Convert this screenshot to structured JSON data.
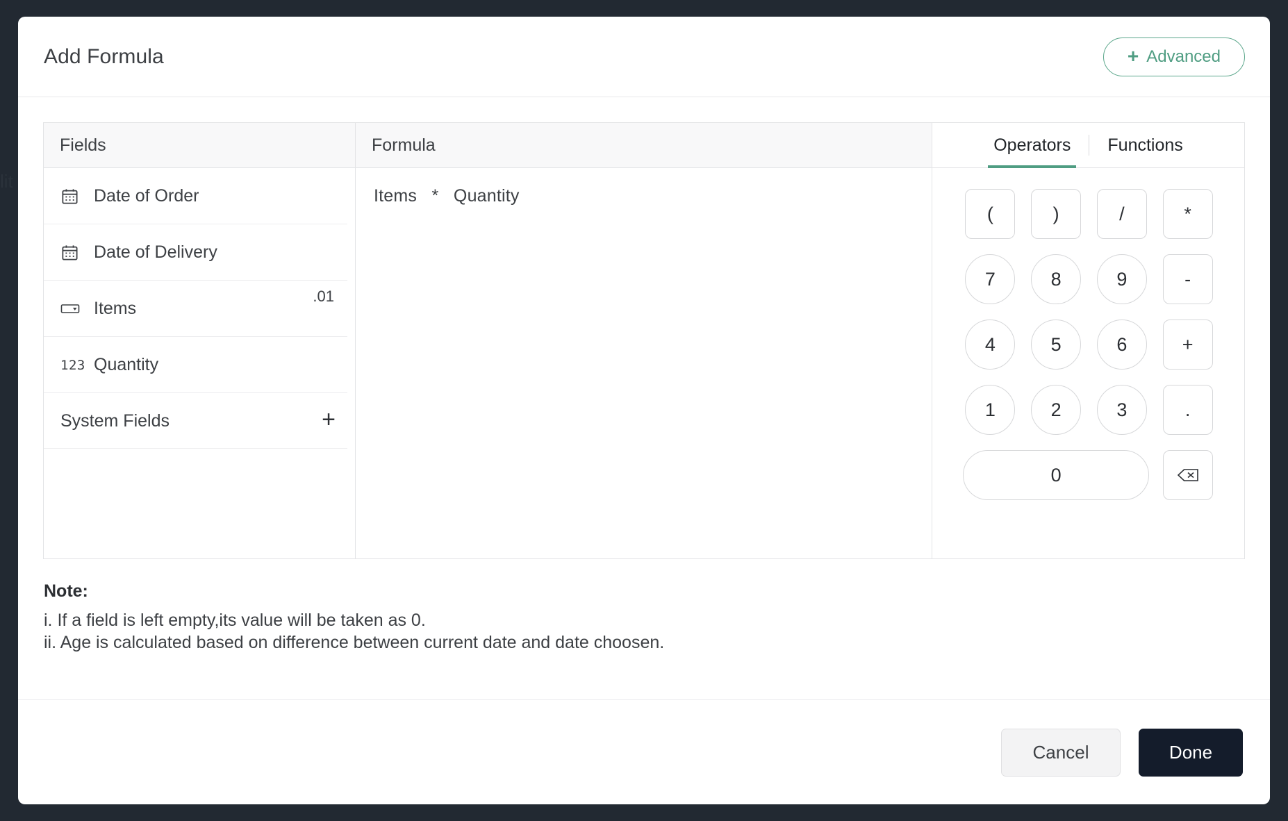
{
  "background_text": "lit",
  "theme": {
    "accent_green": "#4f9d82",
    "done_button_bg": "#141c2b",
    "page_bg": "#222932",
    "panel_border": "#e3e4e6"
  },
  "header": {
    "title": "Add Formula",
    "advanced_button": {
      "label": "Advanced",
      "icon": "plus-icon"
    }
  },
  "fields_panel": {
    "header": "Fields",
    "items": [
      {
        "label": "Date of Order",
        "icon": "calendar-icon",
        "badge": ""
      },
      {
        "label": "Date of Delivery",
        "icon": "calendar-icon",
        "badge": ""
      },
      {
        "label": "Items",
        "icon": "decimal-field-icon",
        "badge": ".01"
      },
      {
        "label": "Quantity",
        "icon": "number-123-icon",
        "badge": ""
      }
    ],
    "system_fields": {
      "label": "System Fields",
      "add_icon": "plus-icon"
    }
  },
  "formula_panel": {
    "header": "Formula",
    "expression": "Items   *   Quantity"
  },
  "keys_panel": {
    "tabs": [
      {
        "label": "Operators",
        "active": true
      },
      {
        "label": "Functions",
        "active": false
      }
    ],
    "keys": [
      {
        "label": "(",
        "type": "op"
      },
      {
        "label": ")",
        "type": "op"
      },
      {
        "label": "/",
        "type": "op"
      },
      {
        "label": "*",
        "type": "op"
      },
      {
        "label": "7",
        "type": "digit"
      },
      {
        "label": "8",
        "type": "digit"
      },
      {
        "label": "9",
        "type": "digit"
      },
      {
        "label": "-",
        "type": "op"
      },
      {
        "label": "4",
        "type": "digit"
      },
      {
        "label": "5",
        "type": "digit"
      },
      {
        "label": "6",
        "type": "digit"
      },
      {
        "label": "+",
        "type": "op"
      },
      {
        "label": "1",
        "type": "digit"
      },
      {
        "label": "2",
        "type": "digit"
      },
      {
        "label": "3",
        "type": "digit"
      },
      {
        "label": ".",
        "type": "op"
      },
      {
        "label": "0",
        "type": "zero"
      },
      {
        "label": "",
        "type": "back",
        "icon": "backspace-icon"
      }
    ]
  },
  "note": {
    "title": "Note:",
    "lines": [
      "i. If a field is left empty,its value will be taken as 0.",
      "ii. Age is calculated based on difference between current date and date choosen."
    ]
  },
  "footer": {
    "cancel_label": "Cancel",
    "done_label": "Done"
  }
}
